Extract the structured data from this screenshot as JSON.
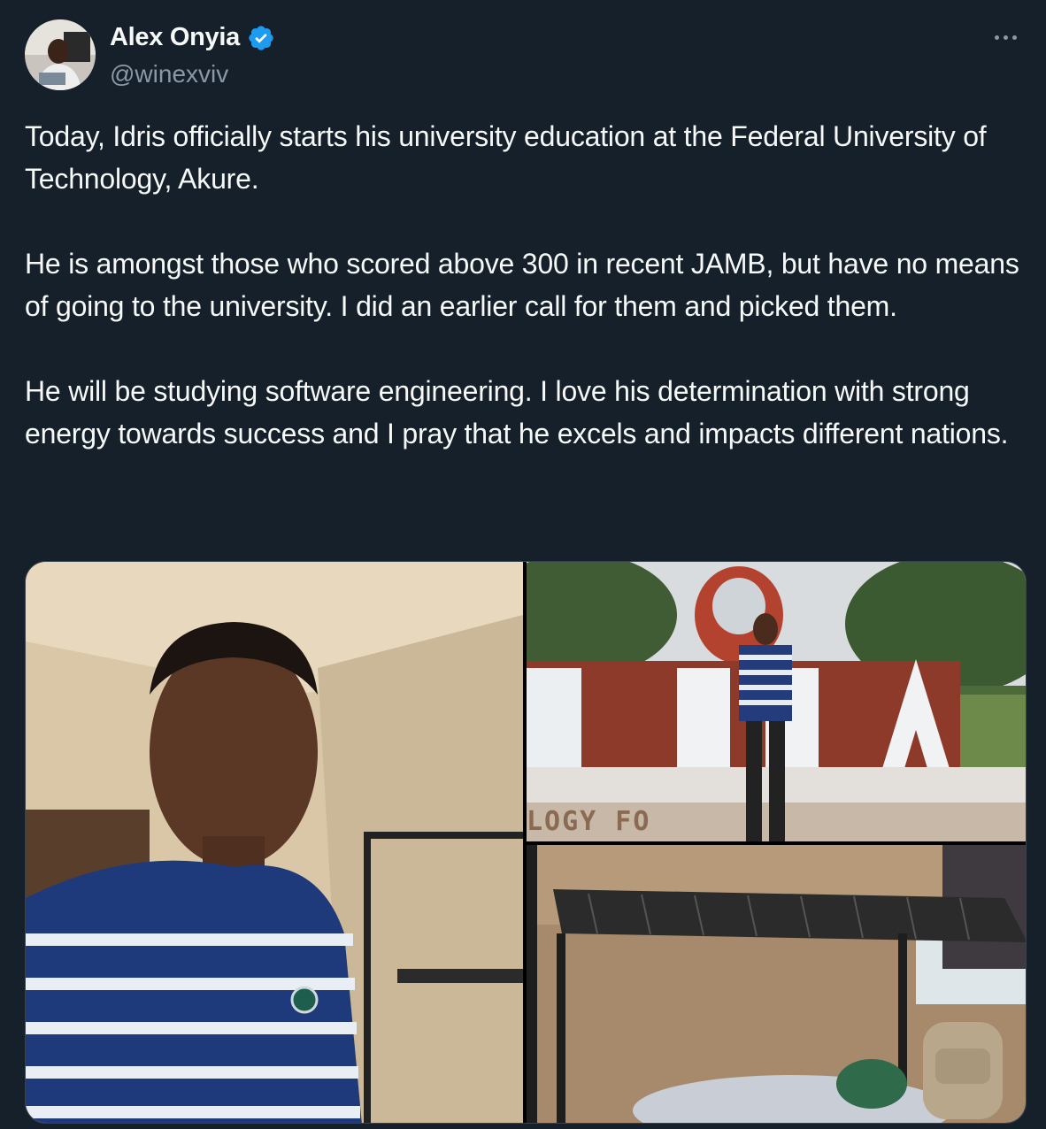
{
  "author": {
    "display_name": "Alex Onyia",
    "handle": "@winexviv",
    "verified": true,
    "avatar_icon": "user-avatar"
  },
  "tweet": {
    "paragraphs": [
      "Today, Idris officially starts his university education at the Federal University of Technology, Akure.",
      "He is amongst those who scored above 300 in recent JAMB, but have no means of going to the university. I did an earlier call for them and picked them.",
      "He will be studying software engineering. I love his determination with strong energy towards success and I pray that he excels and impacts different nations."
    ]
  },
  "media": {
    "photos": [
      {
        "description_icon": "selfie-photo"
      },
      {
        "description_icon": "campus-sign-photo",
        "sign_letters": "FUTA",
        "sign_base_text": "LOGY FO"
      },
      {
        "description_icon": "dorm-bed-photo"
      }
    ]
  },
  "colors": {
    "background": "#15202b",
    "text": "#f7f9f9",
    "secondary": "#8b98a5",
    "verified": "#1d9bf0"
  }
}
